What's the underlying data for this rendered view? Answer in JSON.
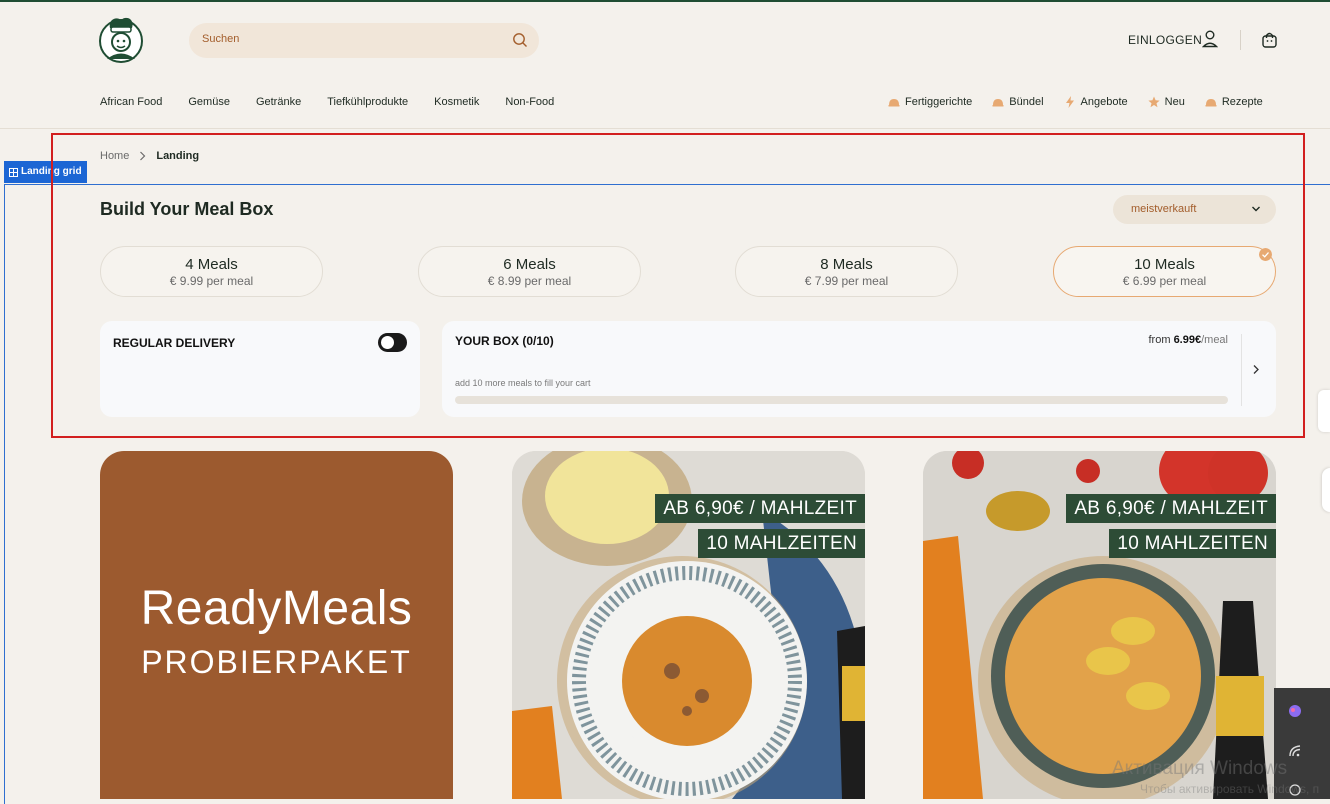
{
  "header": {
    "search_placeholder": "Suchen",
    "login_label": "EINLOGGEN"
  },
  "nav": {
    "main": [
      "African Food",
      "Gemüse",
      "Getränke",
      "Tiefkühlprodukte",
      "Kosmetik",
      "Non-Food"
    ],
    "special": [
      {
        "label": "Fertiggerichte",
        "icon": "dish-icon"
      },
      {
        "label": "Bündel",
        "icon": "dish-icon"
      },
      {
        "label": "Angebote",
        "icon": "lightning-icon"
      },
      {
        "label": "Neu",
        "icon": "star-icon"
      },
      {
        "label": "Rezepte",
        "icon": "dish-icon"
      }
    ]
  },
  "editor": {
    "landing_tag": "Landing grid"
  },
  "breadcrumb": {
    "home": "Home",
    "current": "Landing"
  },
  "builder": {
    "title": "Build Your Meal Box",
    "sort_value": "meistverkauft",
    "options": [
      {
        "name": "4 Meals",
        "price": "€ 9.99 per meal",
        "selected": false
      },
      {
        "name": "6 Meals",
        "price": "€ 8.99 per meal",
        "selected": false
      },
      {
        "name": "8 Meals",
        "price": "€ 7.99 per meal",
        "selected": false
      },
      {
        "name": "10 Meals",
        "price": "€ 6.99 per meal",
        "selected": true
      }
    ],
    "delivery_label": "REGULAR DELIVERY",
    "delivery_enabled": false,
    "box_title": "YOUR BOX (0/10)",
    "box_price_prefix": "from",
    "box_price_value": "6.99€",
    "box_price_unit": "/meal",
    "box_hint": "add 10 more meals to fill your cart",
    "box_progress": 0
  },
  "products": {
    "tile1_line1": "ReadyMeals",
    "tile1_line2": "PROBIERPAKET",
    "tile2_badge1": "AB 6,90€ / MAHLZEIT",
    "tile2_badge2": "10 MAHLZEITEN",
    "tile3_badge1": "AB 6,90€ / MAHLZEIT",
    "tile3_badge2": "10 MAHLZEITEN"
  },
  "system": {
    "watermark_line1": "Активация Windows",
    "watermark_line2": "Чтобы активировать Windows, п"
  },
  "colors": {
    "brand_green": "#1f4d33",
    "accent_orange": "#e7a972",
    "search_bg": "#f1e6d9",
    "tile_brown": "#9c5a2f",
    "badge_green": "#2d4c36",
    "selection_blue": "#1c66d4",
    "annotation_red": "#d21f1f"
  }
}
